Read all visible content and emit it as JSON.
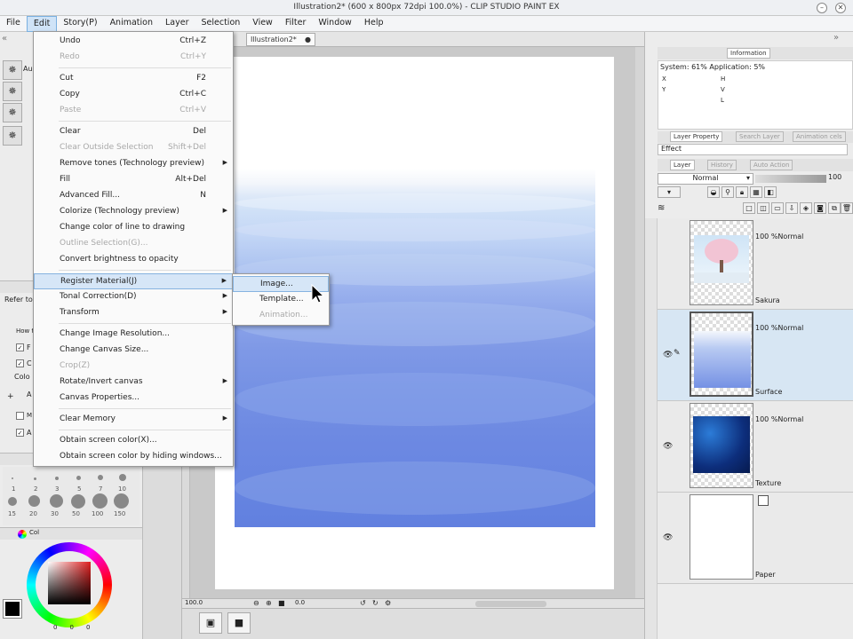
{
  "window": {
    "title": "Illustration2* (600 x 800px 72dpi 100.0%) - CLIP STUDIO PAINT EX",
    "minimize": "–",
    "close": "✕"
  },
  "menubar": [
    "File",
    "Edit",
    "Story(P)",
    "Animation",
    "Layer",
    "Selection",
    "View",
    "Filter",
    "Window",
    "Help"
  ],
  "edit_menu": [
    {
      "label": "Undo",
      "shortcut": "Ctrl+Z",
      "disabled": false
    },
    {
      "label": "Redo",
      "shortcut": "Ctrl+Y",
      "disabled": true
    },
    {
      "label": "Cut",
      "shortcut": "F2",
      "disabled": false
    },
    {
      "label": "Copy",
      "shortcut": "Ctrl+C",
      "disabled": false
    },
    {
      "label": "Paste",
      "shortcut": "Ctrl+V",
      "disabled": true
    },
    {
      "label": "Clear",
      "shortcut": "Del",
      "disabled": false
    },
    {
      "label": "Clear Outside Selection",
      "shortcut": "Shift+Del",
      "disabled": true
    },
    {
      "label": "Remove tones (Technology preview)",
      "shortcut": "",
      "disabled": false,
      "submenu": true
    },
    {
      "label": "Fill",
      "shortcut": "Alt+Del",
      "disabled": false
    },
    {
      "label": "Advanced Fill...",
      "shortcut": "N",
      "disabled": false
    },
    {
      "label": "Colorize (Technology preview)",
      "shortcut": "",
      "disabled": false,
      "submenu": true
    },
    {
      "label": "Change color of line to drawing",
      "shortcut": "",
      "disabled": false
    },
    {
      "label": "Outline Selection(G)...",
      "shortcut": "",
      "disabled": true
    },
    {
      "label": "Convert brightness to opacity",
      "shortcut": "",
      "disabled": false
    },
    {
      "label": "Register Material(J)",
      "shortcut": "",
      "disabled": false,
      "submenu": true,
      "highlighted": true
    },
    {
      "label": "Tonal Correction(D)",
      "shortcut": "",
      "disabled": false,
      "submenu": true
    },
    {
      "label": "Transform",
      "shortcut": "",
      "disabled": false,
      "submenu": true
    },
    {
      "label": "Change Image Resolution...",
      "shortcut": "",
      "disabled": false
    },
    {
      "label": "Change Canvas Size...",
      "shortcut": "",
      "disabled": false
    },
    {
      "label": "Crop(Z)",
      "shortcut": "",
      "disabled": true
    },
    {
      "label": "Rotate/Invert canvas",
      "shortcut": "",
      "disabled": false,
      "submenu": true
    },
    {
      "label": "Canvas Properties...",
      "shortcut": "",
      "disabled": false
    },
    {
      "label": "Clear Memory",
      "shortcut": "",
      "disabled": false,
      "submenu": true
    },
    {
      "label": "Obtain screen color(X)...",
      "shortcut": "",
      "disabled": false
    },
    {
      "label": "Obtain screen color by hiding windows...",
      "shortcut": "",
      "disabled": false
    }
  ],
  "register_submenu": [
    {
      "label": "Image...",
      "disabled": false,
      "highlighted": true
    },
    {
      "label": "Template...",
      "disabled": false
    },
    {
      "label": "Animation...",
      "disabled": true
    }
  ],
  "canvas": {
    "tab_label": "Illustration2*",
    "zoom": "100.0",
    "angle": "0.0"
  },
  "left_panel": {
    "tool_label": "Au",
    "refer_label": "Refer to",
    "how_label": "How t",
    "color_label": "Colo",
    "color_tab": "Col",
    "brush_sizes_top": [
      "1",
      "2",
      "3",
      "5",
      "7",
      "10"
    ],
    "brush_sizes_bottom": [
      "15",
      "20",
      "30",
      "50",
      "100",
      "150"
    ],
    "checks": [
      "F",
      "C",
      "A",
      "M",
      "A"
    ],
    "color_values": [
      "0",
      "0",
      "0"
    ]
  },
  "right_panel": {
    "info_tab": "Information",
    "info_system": "System: 61% Application: 5%",
    "info_fields": [
      "X",
      "Y",
      "H",
      "V",
      "L"
    ],
    "layer_property_tab": "Layer Property",
    "search_layer_tab": "Search Layer",
    "animation_cels_tab": "Animation cels",
    "effect_label": "Effect",
    "layer_tab": "Layer",
    "history_tab": "History",
    "auto_action_tab": "Auto Action",
    "blend_mode": "Normal",
    "opacity": "100",
    "layers": [
      {
        "name": "Sakura",
        "mode": "100 %Normal",
        "visible": false,
        "selected": false,
        "kind": "sakura"
      },
      {
        "name": "Surface",
        "mode": "100 %Normal",
        "visible": true,
        "selected": true,
        "kind": "surface"
      },
      {
        "name": "Texture",
        "mode": "100 %Normal",
        "visible": true,
        "selected": false,
        "kind": "texture"
      },
      {
        "name": "Paper",
        "mode": "",
        "visible": true,
        "selected": false,
        "kind": "paper"
      }
    ]
  },
  "colors": {
    "menu_highlight": "#d6e6f7",
    "selected_layer": "#d7e6f3",
    "water": "#7591e4"
  }
}
